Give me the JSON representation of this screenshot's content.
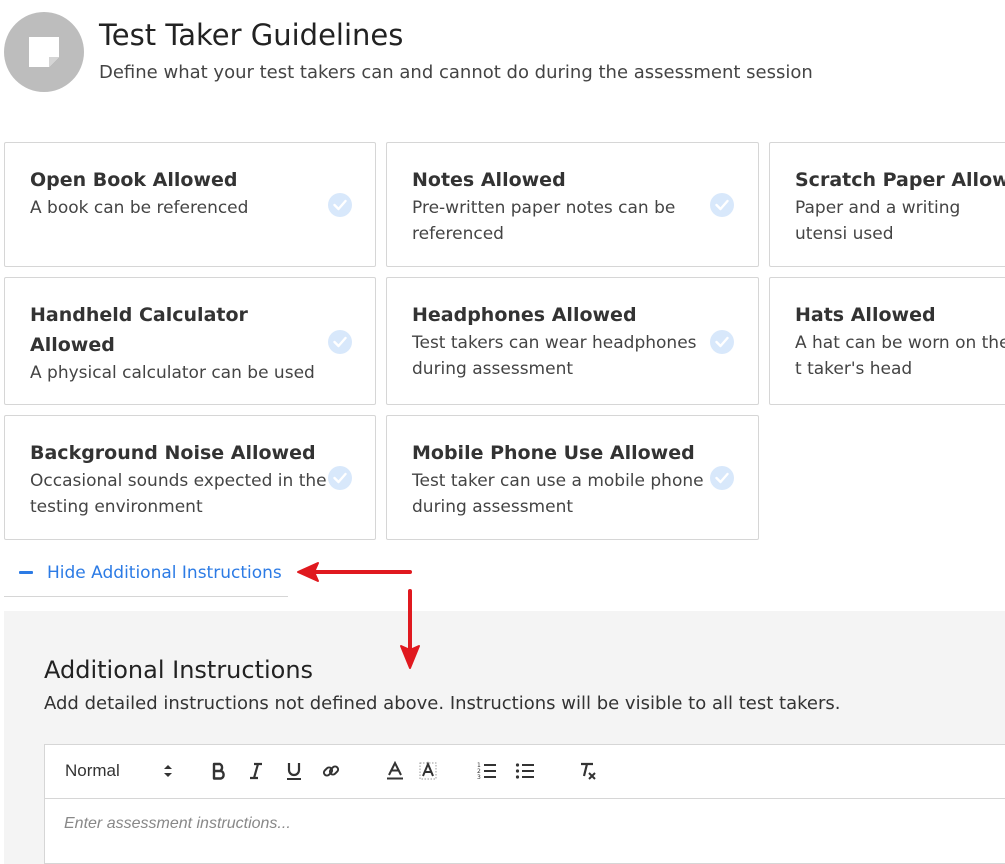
{
  "header": {
    "title": "Test Taker Guidelines",
    "subtitle": "Define what your test takers can and cannot do during the assessment session",
    "icon": "sticky-note-icon"
  },
  "guidelines": [
    {
      "title": "Open Book Allowed",
      "description": "A book can be referenced",
      "checked": true
    },
    {
      "title": "Notes Allowed",
      "description": "Pre-written paper notes can be referenced",
      "checked": true
    },
    {
      "title": "Scratch Paper Allowe",
      "description": "Paper and a writing utensi used",
      "checked": true
    },
    {
      "title": "Handheld Calculator Allowed",
      "description": "A physical calculator can be used",
      "checked": true
    },
    {
      "title": "Headphones Allowed",
      "description": "Test takers can wear headphones during assessment",
      "checked": true
    },
    {
      "title": "Hats Allowed",
      "description": "A hat can be worn on the t taker's head",
      "checked": true
    },
    {
      "title": "Background Noise Allowed",
      "description": "Occasional sounds expected in the testing environment",
      "checked": true
    },
    {
      "title": "Mobile Phone Use Allowed",
      "description": "Test taker can use a mobile phone during assessment",
      "checked": true
    }
  ],
  "toggle": {
    "label": "Hide Additional Instructions",
    "icon": "minus-icon"
  },
  "additional": {
    "title": "Additional Instructions",
    "description": "Add detailed instructions not defined above. Instructions will be visible to all test takers.",
    "editor": {
      "format_value": "Normal",
      "placeholder": "Enter assessment instructions...",
      "tools": [
        "bold-icon",
        "italic-icon",
        "underline-icon",
        "link-icon",
        "font-color-icon",
        "background-color-icon",
        "ordered-list-icon",
        "bullet-list-icon",
        "clear-format-icon"
      ]
    }
  },
  "colors": {
    "accent": "#2c7be5",
    "check_bg": "#d8e8fb",
    "annotation": "#e0191f",
    "panel_bg": "#f4f4f4"
  }
}
